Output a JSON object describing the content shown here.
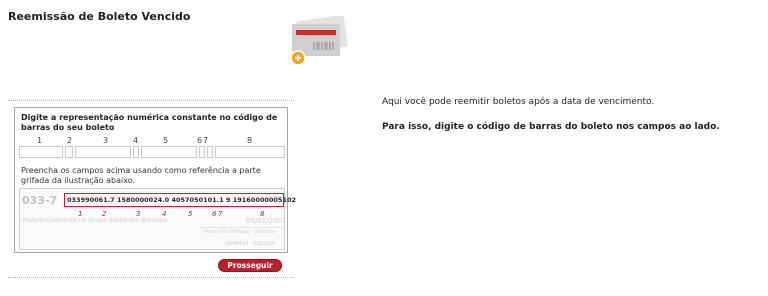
{
  "page": {
    "title": "Reemissão de Boleto Vencido"
  },
  "form": {
    "heading": "Digite a representação numérica constante no código de barras do seu boleto",
    "field_numbers": [
      "1",
      "2",
      "3",
      "4",
      "5",
      "6",
      "7",
      "8"
    ],
    "instruction": "Preencha os campos acima usando como referência a parte grifada da ilustração abaixo.",
    "submit_label": "Prosseguir"
  },
  "illustration": {
    "bank_code": "033-7",
    "barcode_line": "033990061.7  1580000024.0  4057050101.1   9   19160000005102",
    "ref_numbers": [
      "1",
      "2",
      "3",
      "4",
      "5",
      "6",
      "7",
      "8"
    ],
    "faded_bank": "Preferencialmente no Grupo Santander Banespa",
    "faded_date": "05/01/2007",
    "faded_addr": "Posto Vila Olímpia - Cedente",
    "faded_nums": "8000414 · 0001158"
  },
  "help": {
    "line1": "Aqui você pode reemitir boletos após a data de vencimento.",
    "line2": "Para isso, digite o código de barras do boleto nos campos ao lado."
  },
  "colors": {
    "accent": "#bf1e2e",
    "icon_bg": "#d8d8d8",
    "icon_orange": "#f4a81e"
  },
  "icons": [
    "boleto-reissue-icon",
    "add-badge-icon"
  ]
}
